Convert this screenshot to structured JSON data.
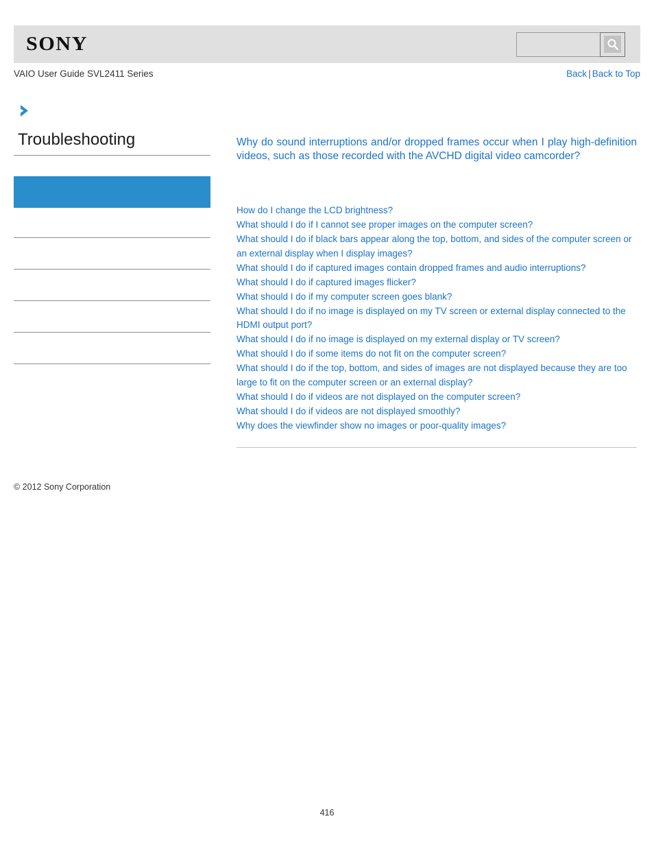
{
  "header": {
    "logo_text": "SONY",
    "search": {
      "value": "",
      "placeholder": "",
      "icon": "search-icon"
    }
  },
  "sub_header": {
    "guide_title": "VAIO User Guide SVL2411 Series",
    "back_label": "Back",
    "separator": "|",
    "back_to_top_label": "Back to Top"
  },
  "sidebar": {
    "chevron_icon": "chevron-right-icon",
    "title": "Troubleshooting",
    "accent_color": "#2a8dcc",
    "items": [
      {
        "label": "",
        "active": true
      },
      {
        "label": "",
        "active": false
      },
      {
        "label": "",
        "active": false
      },
      {
        "label": "",
        "active": false
      },
      {
        "label": "",
        "active": false
      },
      {
        "label": "",
        "active": false
      }
    ]
  },
  "main": {
    "heading": "Why do sound interruptions and/or dropped frames occur when I play high-definition videos, such as those recorded with the AVCHD digital video camcorder?",
    "links": [
      "How do I change the LCD brightness?",
      "What should I do if I cannot see proper images on the computer screen?",
      "What should I do if black bars appear along the top, bottom, and sides of the computer screen or an external display when I display images?",
      "What should I do if captured images contain dropped frames and audio interruptions?",
      "What should I do if captured images flicker?",
      "What should I do if my computer screen goes blank?",
      "What should I do if no image is displayed on my TV screen or external display connected to the HDMI output port?",
      "What should I do if no image is displayed on my external display or TV screen?",
      "What should I do if some items do not fit on the computer screen?",
      "What should I do if the top, bottom, and sides of images are not displayed because they are too large to fit on the computer screen or an external display?",
      "What should I do if videos are not displayed on the computer screen?",
      "What should I do if videos are not displayed smoothly?",
      "Why does the viewfinder show no images or poor-quality images?"
    ]
  },
  "footer": {
    "copyright": "© 2012 Sony Corporation",
    "page_number": "416"
  }
}
